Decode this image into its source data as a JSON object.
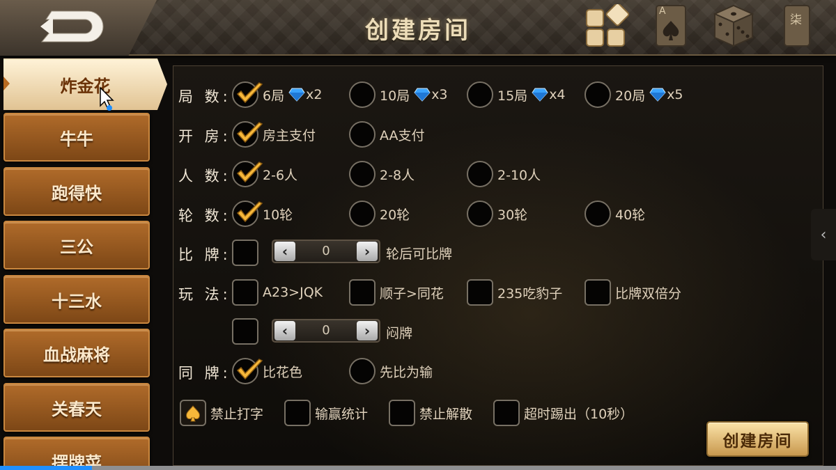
{
  "header": {
    "title": "创建房间",
    "back_icon": "back-arrow-icon",
    "icons": [
      "blocks-menu-icon",
      "ace-of-spades-card-icon",
      "dice-icon",
      "mahjong-tile-icon"
    ],
    "card_corner": "A",
    "mahjong_glyph": "柒"
  },
  "sidebar": {
    "tabs": [
      {
        "label": "炸金花",
        "active": true
      },
      {
        "label": "牛牛"
      },
      {
        "label": "跑得快"
      },
      {
        "label": "三公"
      },
      {
        "label": "十三水"
      },
      {
        "label": "血战麻将"
      },
      {
        "label": "关春天"
      },
      {
        "label": "摆牌菜"
      }
    ]
  },
  "form": {
    "rounds": {
      "label": "局 数:",
      "options": [
        {
          "text": "6局",
          "gems": "x2",
          "checked": true
        },
        {
          "text": "10局",
          "gems": "x3"
        },
        {
          "text": "15局",
          "gems": "x4"
        },
        {
          "text": "20局",
          "gems": "x5"
        }
      ]
    },
    "payment": {
      "label": "开 房:",
      "options": [
        {
          "text": "房主支付",
          "checked": true
        },
        {
          "text": "AA支付"
        }
      ]
    },
    "players": {
      "label": "人 数:",
      "options": [
        {
          "text": "2-6人",
          "checked": true
        },
        {
          "text": "2-8人"
        },
        {
          "text": "2-10人"
        }
      ]
    },
    "turns": {
      "label": "轮 数:",
      "options": [
        {
          "text": "10轮",
          "checked": true
        },
        {
          "text": "20轮"
        },
        {
          "text": "30轮"
        },
        {
          "text": "40轮"
        }
      ]
    },
    "compare": {
      "label": "比 牌:",
      "stepper_value": "0",
      "suffix": "轮后可比牌"
    },
    "play": {
      "label": "玩 法:",
      "options": [
        {
          "text": "A23>JQK"
        },
        {
          "text": "顺子>同花"
        },
        {
          "text": "235吃豹子"
        },
        {
          "text": "比牌双倍分"
        }
      ],
      "stepper_value": "0",
      "stepper_suffix": "闷牌"
    },
    "same_cards": {
      "label": "同 牌:",
      "options": [
        {
          "text": "比花色",
          "checked": true
        },
        {
          "text": "先比为输"
        }
      ]
    },
    "extras": [
      {
        "text": "禁止打字",
        "checked": true
      },
      {
        "text": "输赢统计"
      },
      {
        "text": "禁止解散"
      },
      {
        "text": "超时踢出（10秒）"
      }
    ]
  },
  "create_button": "创建房间",
  "colors": {
    "accent_gold": "#e8c27a",
    "tab_orange": "#9a5a20",
    "gem_blue": "#3aa3ff",
    "progress_blue": "#1f8fff"
  },
  "bottom_progress": 0.11
}
